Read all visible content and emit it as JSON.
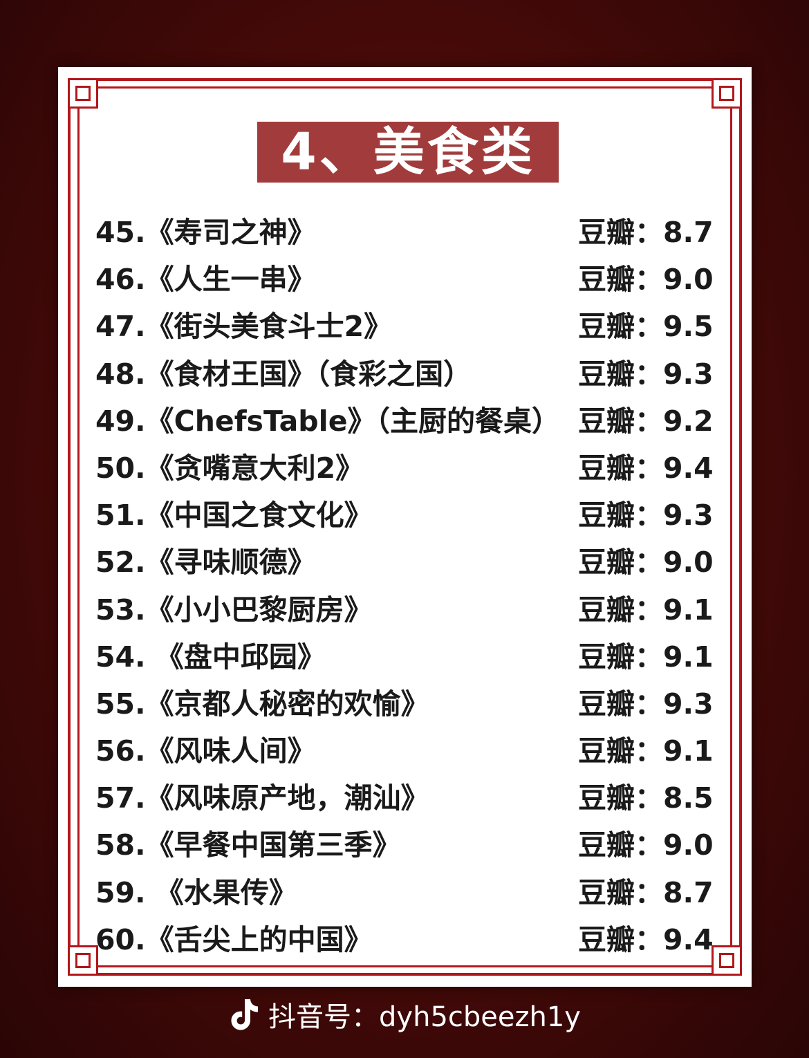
{
  "title": "4、美食类",
  "items": [
    {
      "name": "45.《寿司之神》",
      "score": "豆瓣：8.7"
    },
    {
      "name": "46.《人生一串》",
      "score": "豆瓣：9.0"
    },
    {
      "name": "47.《街头美食斗士2》",
      "score": "豆瓣：9.5"
    },
    {
      "name": "48.《食材王国》（食彩之国）",
      "score": "豆瓣：9.3"
    },
    {
      "name": "49.《ChefsTable》（主厨的餐桌）",
      "score": "豆瓣：9.2"
    },
    {
      "name": "50.《贪嘴意大利2》",
      "score": "豆瓣：9.4"
    },
    {
      "name": "51.《中国之食文化》",
      "score": "豆瓣：9.3"
    },
    {
      "name": "52.《寻味顺德》",
      "score": "豆瓣：9.0"
    },
    {
      "name": "53.《小小巴黎厨房》",
      "score": "豆瓣：9.1"
    },
    {
      "name": "54. 《盘中邱园》",
      "score": "豆瓣：9.1"
    },
    {
      "name": "55.《京都人秘密的欢愉》",
      "score": "豆瓣：9.3"
    },
    {
      "name": "56.《风味人间》",
      "score": "豆瓣：9.1"
    },
    {
      "name": "57.《风味原产地，潮汕》",
      "score": "豆瓣：8.5"
    },
    {
      "name": "58.《早餐中国第三季》",
      "score": "豆瓣：9.0"
    },
    {
      "name": "59. 《水果传》",
      "score": "豆瓣：8.7"
    },
    {
      "name": "60.《舌尖上的中国》",
      "score": "豆瓣：9.4"
    }
  ],
  "footer": {
    "icon": "tiktok-icon",
    "text": "抖音号：dyh5cbeezh1y"
  },
  "colors": {
    "frame": "#b3171b",
    "title_bg": "#a23b3b",
    "background": "#4a0b09"
  }
}
